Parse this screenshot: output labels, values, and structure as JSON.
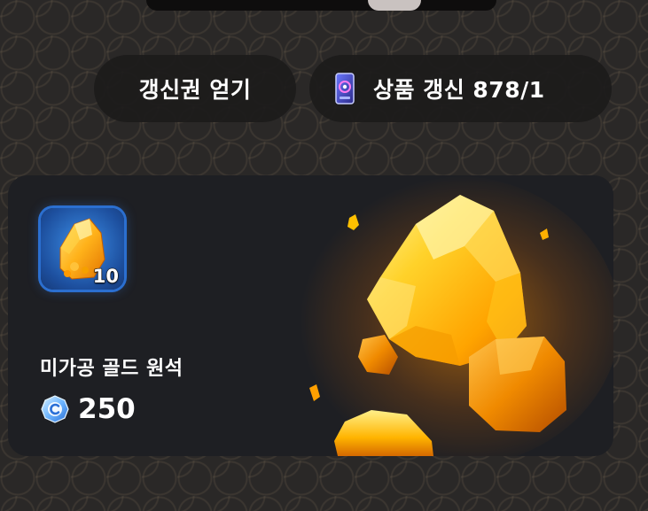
{
  "header": {
    "get_ticket_label": "갱신권 얻기",
    "refresh_label": "상품 갱신 878/1",
    "refresh_icon": "refresh-ticket-icon"
  },
  "product": {
    "name": "미가공 골드 원석",
    "quantity": "10",
    "price": "250",
    "currency_icon": "crystal-coin-icon",
    "item_icon": "gold-ore-icon"
  },
  "colors": {
    "background": "#2a2827",
    "card": "#1e1f23",
    "pill": "#1c1b1b",
    "item_frame": "#2b6fd0",
    "gold": "#ffb000"
  }
}
